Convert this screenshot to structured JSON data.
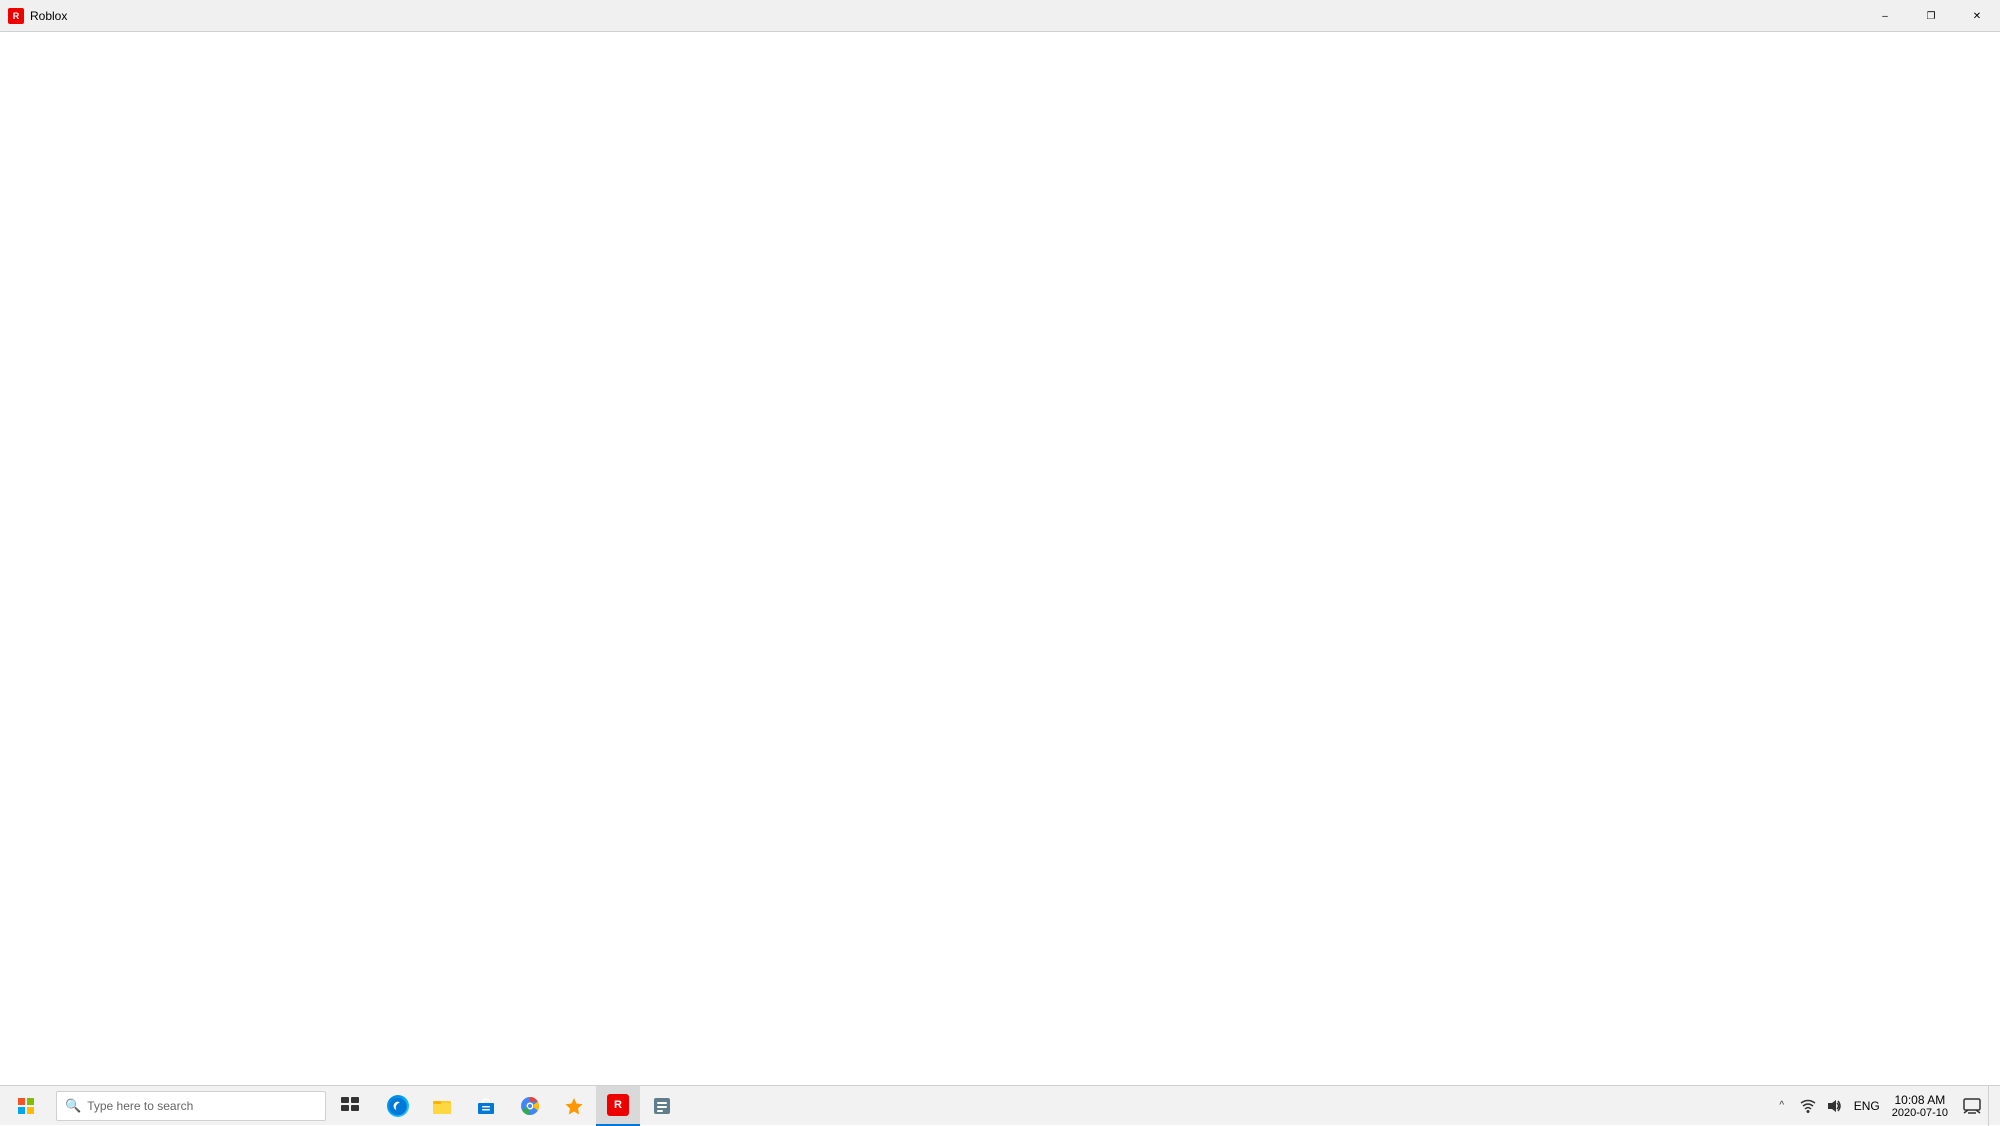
{
  "titlebar": {
    "title": "Roblox",
    "minimize_label": "–",
    "restore_label": "❐",
    "close_label": "✕"
  },
  "main": {
    "background": "#ffffff"
  },
  "taskbar": {
    "search_placeholder": "Type here to search",
    "clock": {
      "time": "10:08 AM",
      "date": "2020-07-10"
    },
    "language": "ENG",
    "apps": [
      {
        "id": "task-view",
        "label": "Task View"
      },
      {
        "id": "edge",
        "label": "Microsoft Edge"
      },
      {
        "id": "file-explorer",
        "label": "File Explorer"
      },
      {
        "id": "store",
        "label": "Microsoft Store"
      },
      {
        "id": "chrome",
        "label": "Google Chrome"
      },
      {
        "id": "app1",
        "label": "Pinned App 1"
      },
      {
        "id": "app2",
        "label": "Pinned App 2"
      },
      {
        "id": "app3",
        "label": "Pinned App 3"
      }
    ],
    "tray": {
      "overflow_label": "^",
      "network_label": "Network",
      "volume_label": "Volume",
      "action_center_label": "Action Center"
    }
  }
}
